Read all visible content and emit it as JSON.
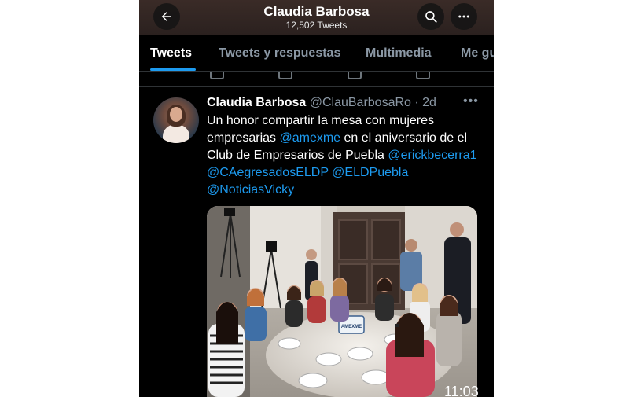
{
  "header": {
    "title": "Claudia Barbosa",
    "tweet_count": "12,502 Tweets",
    "back_icon": "arrow-left-icon",
    "search_icon": "search-icon",
    "more_icon": "more-horizontal-icon"
  },
  "tabs": [
    {
      "label": "Tweets",
      "active": true
    },
    {
      "label": "Tweets y respuestas",
      "active": false
    },
    {
      "label": "Multimedia",
      "active": false
    },
    {
      "label": "Me gu",
      "active": false
    }
  ],
  "tweet": {
    "name": "Claudia Barbosa",
    "handle": "@ClauBarbosaRo",
    "separator": " · ",
    "age": "2d",
    "text_part1": "Un honor compartir la mesa con mujeres empresarias ",
    "mention1": "@amexme",
    "text_part2": " en el aniversario de el Club de Empresarios de Puebla ",
    "mention2": "@erickbecerra1",
    "mention3": "@CAegresadosELDP",
    "mention4": "@ELDPuebla",
    "mention5": "@NoticiasVicky",
    "photo_sign": "AMEXME"
  },
  "status_time": "11:03",
  "colors": {
    "accent": "#1d9bf0",
    "background": "#000000",
    "header": "#2b211f",
    "text_secondary": "#8b98a5"
  }
}
